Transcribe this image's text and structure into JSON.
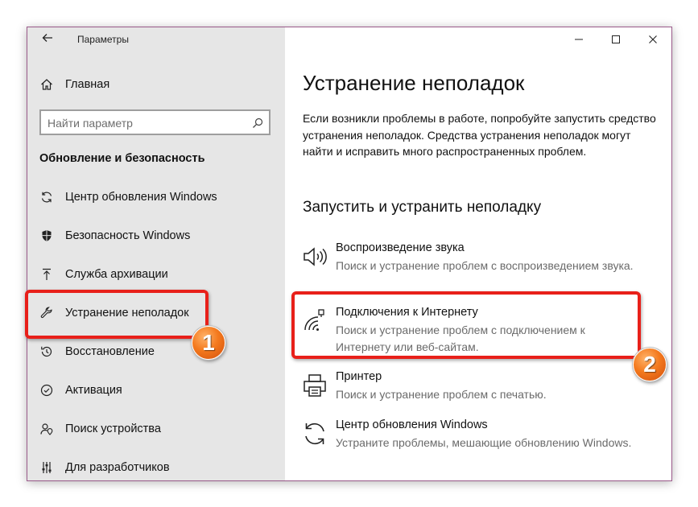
{
  "window": {
    "title": "Параметры",
    "controls": {
      "minimize_icon": "minimize-icon",
      "maximize_icon": "maximize-icon",
      "close_icon": "close-icon"
    }
  },
  "sidebar": {
    "home": {
      "label": "Главная",
      "icon": "home-icon"
    },
    "search": {
      "placeholder": "Найти параметр",
      "value": "",
      "icon": "search-icon"
    },
    "section_title": "Обновление и безопасность",
    "items": [
      {
        "label": "Центр обновления Windows",
        "icon": "refresh-icon"
      },
      {
        "label": "Безопасность Windows",
        "icon": "shield-icon"
      },
      {
        "label": "Служба архивации",
        "icon": "upload-icon"
      },
      {
        "label": "Устранение неполадок",
        "icon": "wrench-icon",
        "selected": true
      },
      {
        "label": "Восстановление",
        "icon": "history-icon"
      },
      {
        "label": "Активация",
        "icon": "check-circle-icon"
      },
      {
        "label": "Поиск устройства",
        "icon": "person-location-icon"
      },
      {
        "label": "Для разработчиков",
        "icon": "sliders-icon"
      }
    ]
  },
  "main": {
    "title": "Устранение неполадок",
    "description": "Если возникли проблемы в работе, попробуйте запустить средство устранения неполадок. Средства устранения неполадок могут найти и исправить много распространенных проблем.",
    "section_title": "Запустить и устранить неполадку",
    "troubleshooters": [
      {
        "name": "Воспроизведение звука",
        "description": "Поиск и устранение проблем с воспроизведением звука.",
        "icon": "speaker-icon"
      },
      {
        "name": "Подключения к Интернету",
        "description": "Поиск и устранение проблем с подключением к Интернету или веб-сайтам.",
        "icon": "wifi-signal-icon"
      },
      {
        "name": "Принтер",
        "description": "Поиск и устранение проблем с печатью.",
        "icon": "printer-icon"
      },
      {
        "name": "Центр обновления Windows",
        "description": "Устраните проблемы, мешающие обновлению Windows.",
        "icon": "refresh-icon"
      }
    ]
  },
  "annotations": {
    "badge_1": "1",
    "badge_2": "2",
    "highlight_color": "#e8201a",
    "badge_color": "#f47a1e"
  }
}
